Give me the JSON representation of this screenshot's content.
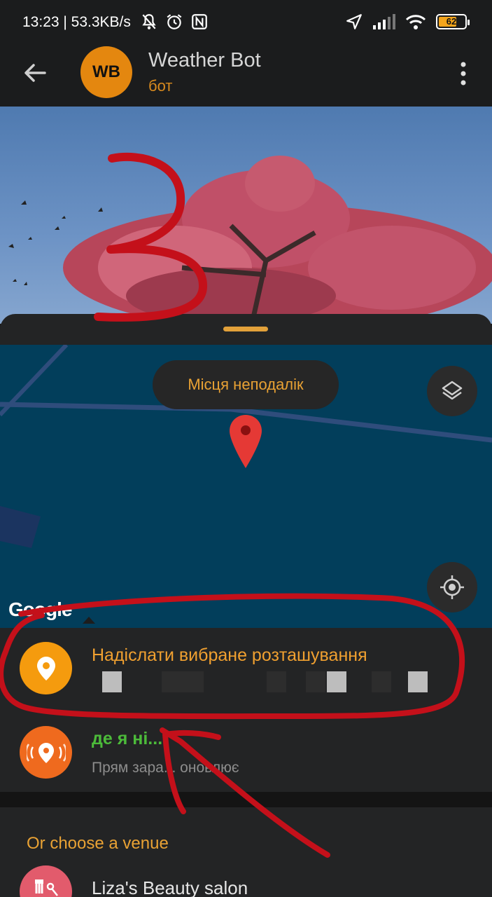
{
  "status_bar": {
    "time_speed": "13:23 | 53.3KB/s",
    "battery": "62",
    "icons": [
      "mute-icon",
      "alarm-icon",
      "nfc-icon",
      "location-arrow-icon",
      "signal-icon",
      "wifi-icon",
      "battery-icon"
    ]
  },
  "header": {
    "avatar_initials": "WB",
    "title": "Weather Bot",
    "subtitle": "бот",
    "avatar_color": "#e4870f"
  },
  "map": {
    "nearby_label": "Місця неподалік",
    "logo": "Google"
  },
  "send_selected": {
    "title": "Надіслати вибране розташування",
    "title_color": "#f0a030",
    "icon_color": "#f59b0e"
  },
  "live_location": {
    "title": "де я ні...",
    "subtitle": "Прям зара... оновлює",
    "title_color": "#4cbb3a",
    "icon_color": "#ef6a1e"
  },
  "venues": {
    "header": "Or choose a venue",
    "items": [
      {
        "name": "Liza's Beauty salon",
        "icon": "scissors-icon",
        "icon_color": "#e25b6c"
      }
    ]
  },
  "annotation": {
    "number": "3",
    "color": "#c4101a"
  }
}
